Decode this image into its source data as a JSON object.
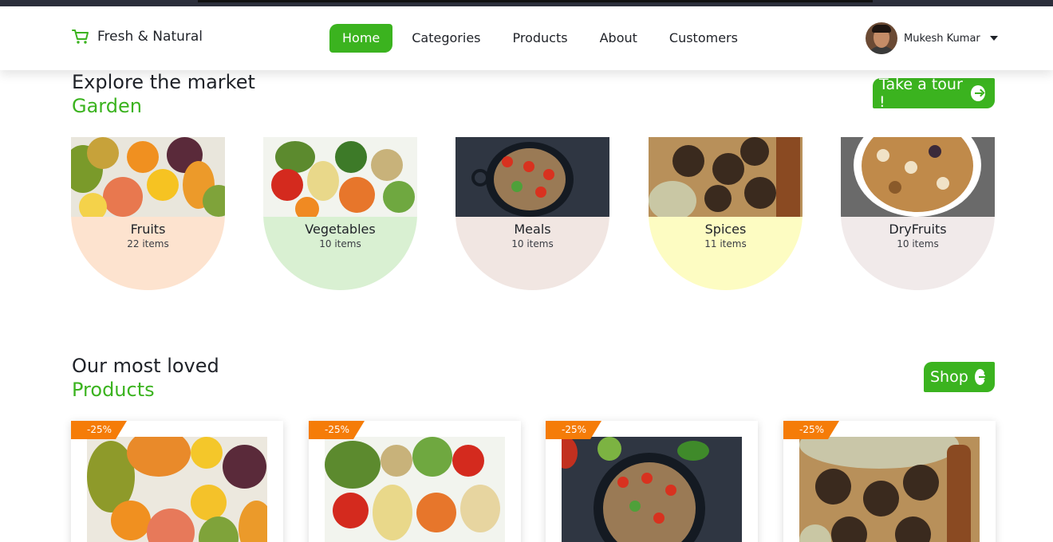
{
  "header": {
    "brand": "Fresh & Natural",
    "nav": [
      "Home",
      "Categories",
      "Products",
      "About",
      "Customers"
    ],
    "active_nav": "Home",
    "user_name": "Mukesh Kumar"
  },
  "explore": {
    "title": "Explore the market",
    "subtitle": "Garden",
    "cta": "Take a tour !",
    "categories": [
      {
        "name": "Fruits",
        "count": "22 items",
        "bg": "#fde3cf"
      },
      {
        "name": "Vegetables",
        "count": "10 items",
        "bg": "#d9f0d2"
      },
      {
        "name": "Meals",
        "count": "10 items",
        "bg": "#f1e6e2"
      },
      {
        "name": "Spices",
        "count": "11 items",
        "bg": "#fdfcc2"
      },
      {
        "name": "DryFruits",
        "count": "10 items",
        "bg": "#f1eaea"
      }
    ]
  },
  "products": {
    "title": "Our most loved",
    "subtitle": "Products",
    "cta": "Shop",
    "items": [
      {
        "discount": "-25%"
      },
      {
        "discount": "-25%"
      },
      {
        "discount": "-25%"
      },
      {
        "discount": "-25%"
      }
    ]
  },
  "colors": {
    "accent": "#3bb31f",
    "badge": "#f57c08"
  },
  "icons": [
    "cart-icon",
    "chevron-down-icon",
    "arrow-circle-icon"
  ]
}
